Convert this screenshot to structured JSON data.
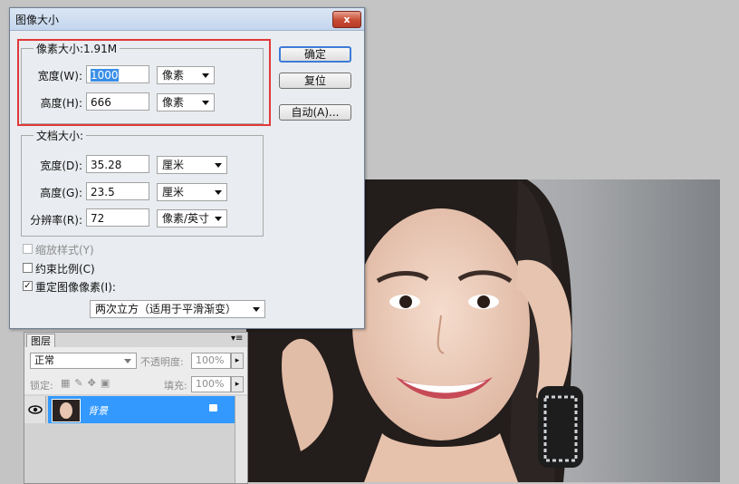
{
  "dialog": {
    "title": "图像大小",
    "close_glyph": "x",
    "pixel_dimensions": {
      "legend": "像素大小:1.91M",
      "width_label": "宽度(W):",
      "width_value": "1000",
      "width_unit": "像素",
      "height_label": "高度(H):",
      "height_value": "666",
      "height_unit": "像素"
    },
    "document_size": {
      "legend": "文档大小:",
      "width_label": "宽度(D):",
      "width_value": "35.28",
      "width_unit": "厘米",
      "height_label": "高度(G):",
      "height_value": "23.5",
      "height_unit": "厘米",
      "resolution_label": "分辨率(R):",
      "resolution_value": "72",
      "resolution_unit": "像素/英寸"
    },
    "options": {
      "scale_styles": "缩放样式(Y)",
      "constrain_proportions": "约束比例(C)",
      "resample": "重定图像像素(I):",
      "resample_check": "✓",
      "resample_method": "两次立方（适用于平滑渐变）"
    },
    "buttons": {
      "ok": "确定",
      "reset": "复位",
      "auto": "自动(A)..."
    }
  },
  "layers_panel": {
    "tab": "图层",
    "blend_mode": "正常",
    "opacity_label": "不透明度:",
    "opacity_value": "100%",
    "lock_label": "锁定:",
    "fill_label": "填充:",
    "fill_value": "100%",
    "layer_name": "背景",
    "menu_glyph": "▾≡"
  }
}
